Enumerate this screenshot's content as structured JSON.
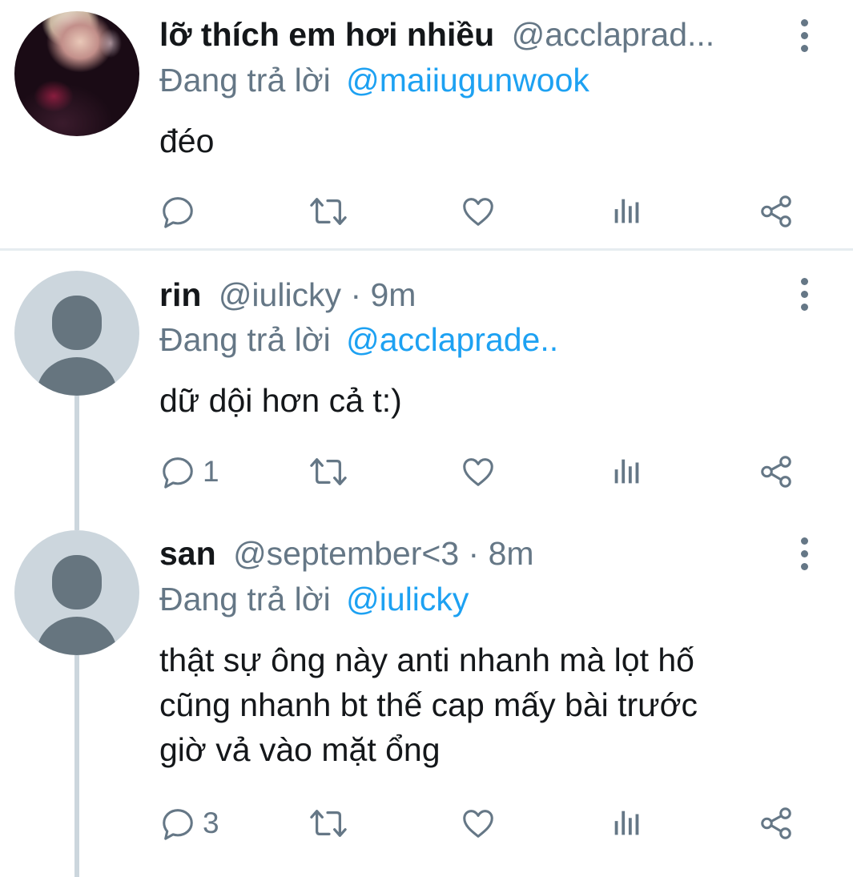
{
  "tweets": [
    {
      "name": "lỡ thích em hơi nhiều",
      "handle": "@acclaprad...",
      "replying_prefix": "Đang trả lời",
      "replying_to": "@maiiugunwook",
      "text": "đéo",
      "reply_count": "",
      "avatar": "photo"
    },
    {
      "name": "rin",
      "handle": "@iulicky · 9m",
      "replying_prefix": "Đang trả lời",
      "replying_to": "@acclaprade..",
      "text": "dữ dội hơn cả t:)",
      "reply_count": "1",
      "avatar": "default"
    },
    {
      "name": "san",
      "handle": "@september<3 · 8m",
      "replying_prefix": "Đang trả lời",
      "replying_to": "@iulicky",
      "text": "thật sự ông này anti nhanh mà lọt hố\ncũng nhanh bt thế cap mấy bài trước\ngiờ vả vào mặt ổng",
      "reply_count": "3",
      "avatar": "default"
    }
  ],
  "icons": {
    "reply": "reply-icon",
    "retweet": "retweet-icon",
    "like": "like-icon",
    "analytics": "analytics-icon",
    "share": "share-icon",
    "more": "more-vertical-icon"
  },
  "colors": {
    "text": "#14171a",
    "secondary": "#657786",
    "link": "#1da1f2",
    "divider": "#e6ecf0",
    "thread_line": "#ccd6dd",
    "default_avatar_bg": "#ccd6dd"
  }
}
